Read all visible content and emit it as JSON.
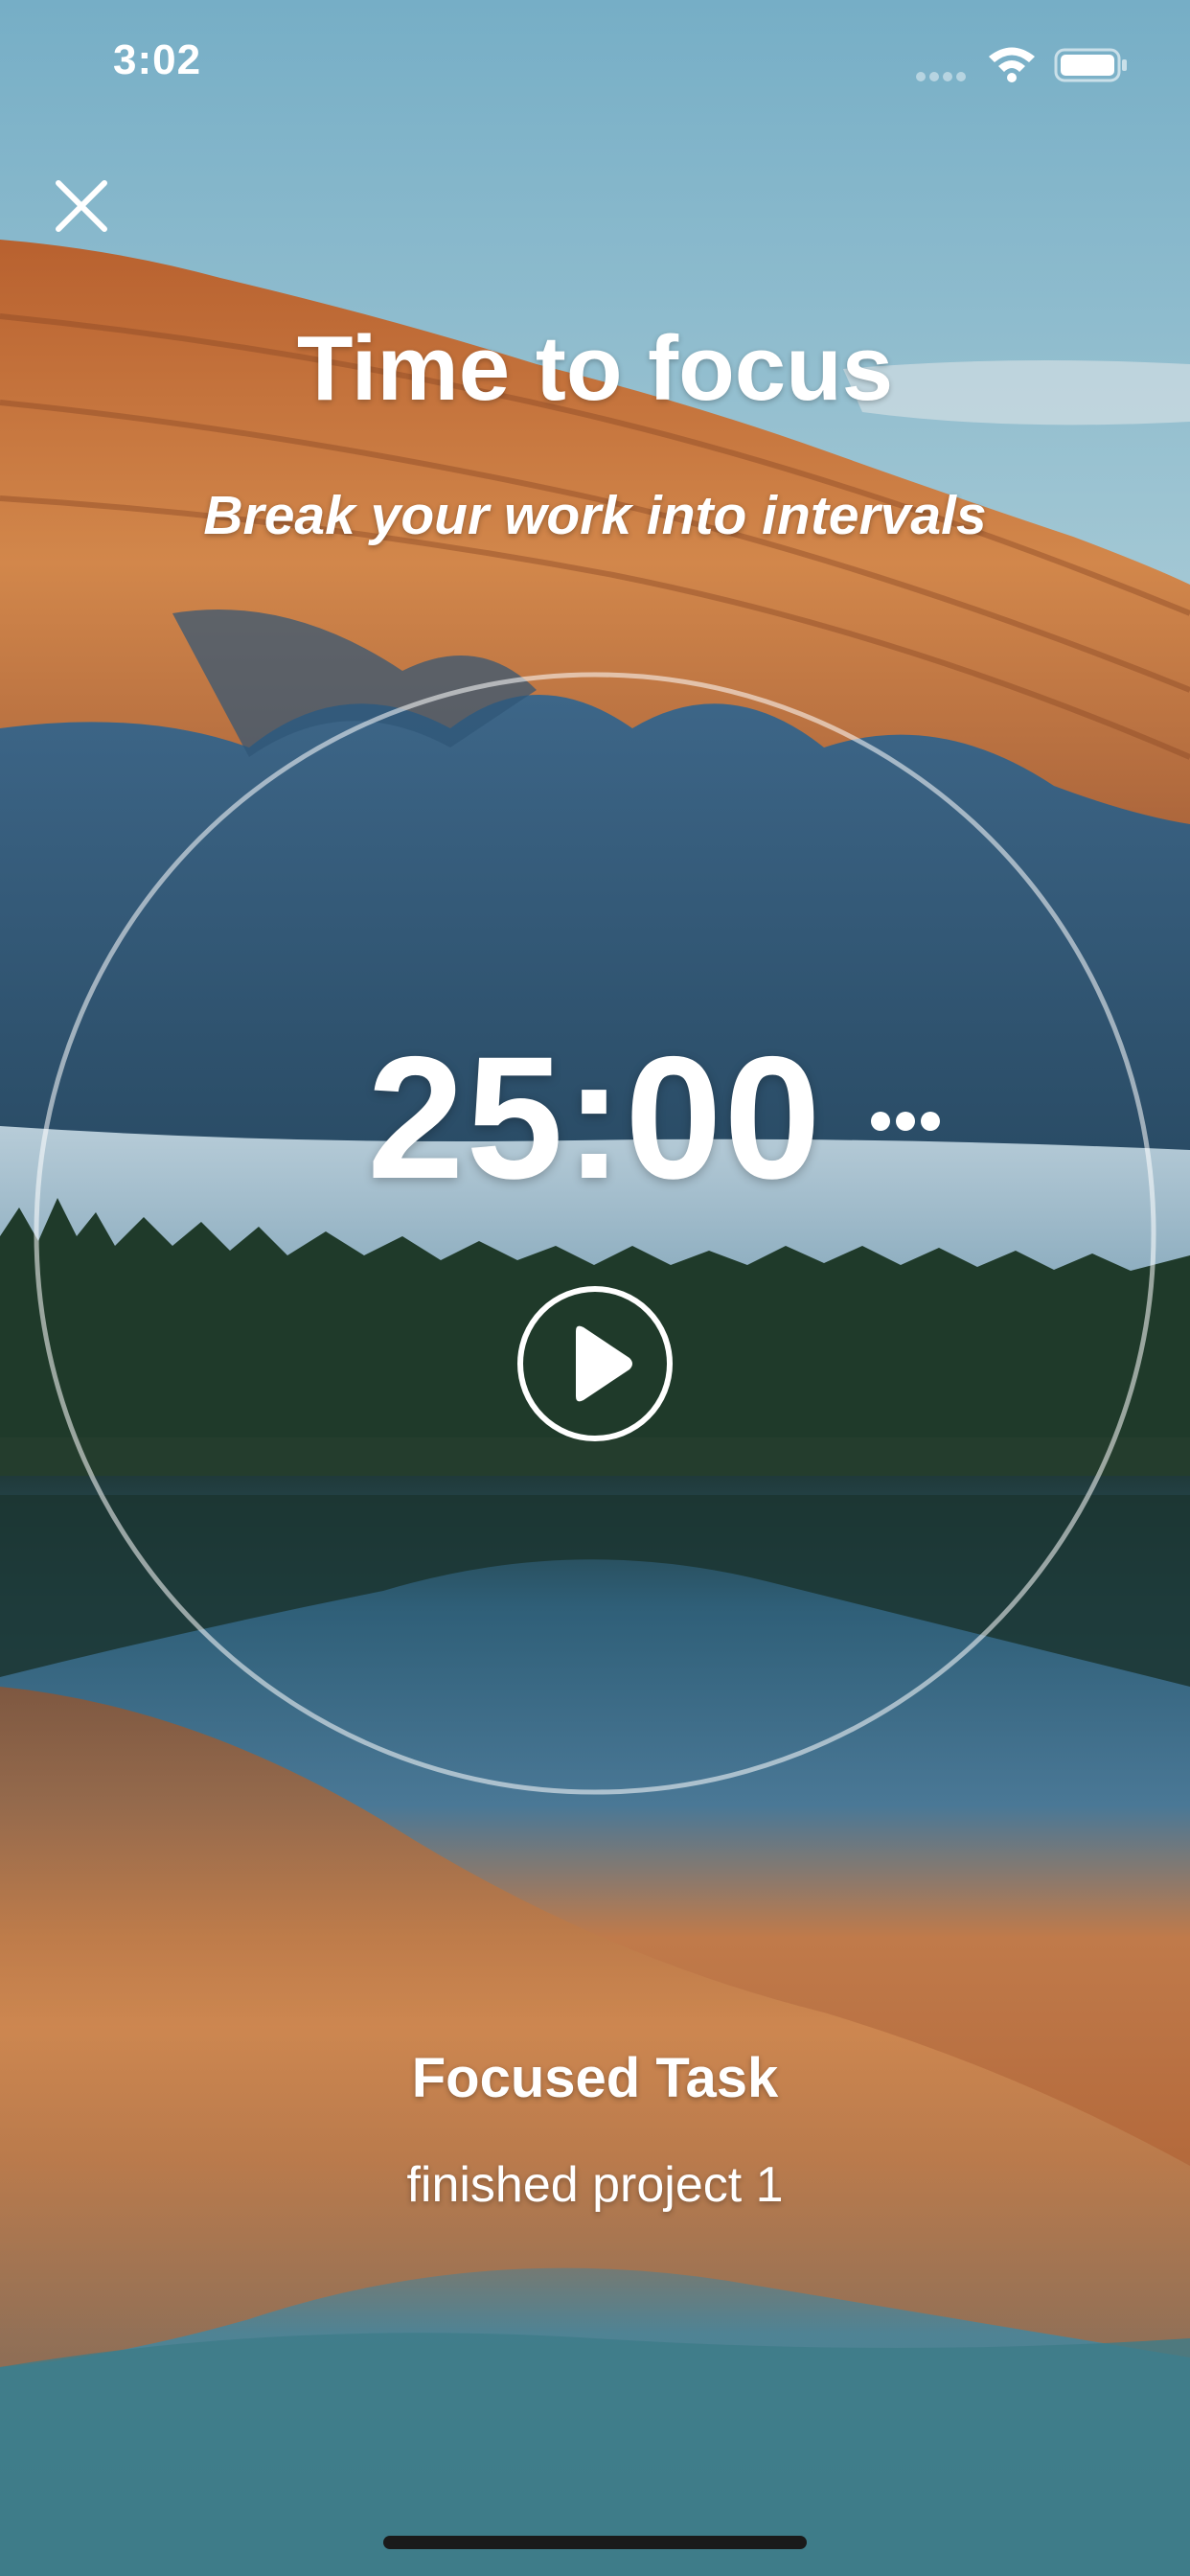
{
  "status_bar": {
    "time": "3:02",
    "icons": [
      "signal-icon",
      "wifi-icon",
      "battery-icon"
    ]
  },
  "header": {
    "close_icon": "close-icon",
    "title": "Time to focus",
    "subtitle": "Break your work into intervals"
  },
  "timer": {
    "display": "25:00",
    "more_icon": "more-horizontal-icon",
    "play_icon": "play-icon"
  },
  "task": {
    "heading": "Focused Task",
    "name": "finished project 1"
  },
  "colors": {
    "text": "#ffffff",
    "ring": "#ffffff",
    "sky": "#7fb3c8",
    "mountain_lit": "#c4703a",
    "mountain_shadow": "#2f5a78",
    "forest": "#1f3a2a",
    "home_indicator": "#1a1a1a"
  }
}
